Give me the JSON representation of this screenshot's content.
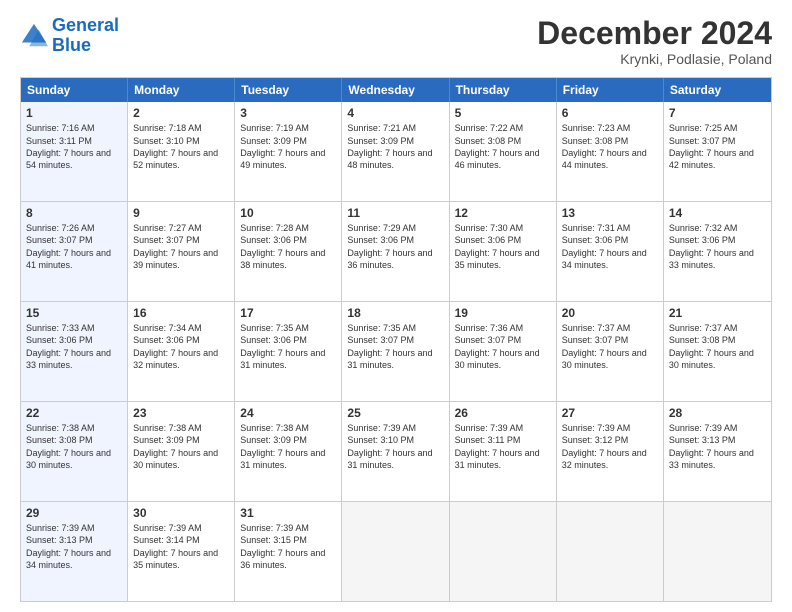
{
  "logo": {
    "line1": "General",
    "line2": "Blue"
  },
  "title": "December 2024",
  "subtitle": "Krynki, Podlasie, Poland",
  "header_days": [
    "Sunday",
    "Monday",
    "Tuesday",
    "Wednesday",
    "Thursday",
    "Friday",
    "Saturday"
  ],
  "rows": [
    [
      {
        "day": "1",
        "sunrise": "Sunrise: 7:16 AM",
        "sunset": "Sunset: 3:11 PM",
        "daylight": "Daylight: 7 hours and 54 minutes.",
        "type": "sunday"
      },
      {
        "day": "2",
        "sunrise": "Sunrise: 7:18 AM",
        "sunset": "Sunset: 3:10 PM",
        "daylight": "Daylight: 7 hours and 52 minutes.",
        "type": "normal"
      },
      {
        "day": "3",
        "sunrise": "Sunrise: 7:19 AM",
        "sunset": "Sunset: 3:09 PM",
        "daylight": "Daylight: 7 hours and 49 minutes.",
        "type": "normal"
      },
      {
        "day": "4",
        "sunrise": "Sunrise: 7:21 AM",
        "sunset": "Sunset: 3:09 PM",
        "daylight": "Daylight: 7 hours and 48 minutes.",
        "type": "normal"
      },
      {
        "day": "5",
        "sunrise": "Sunrise: 7:22 AM",
        "sunset": "Sunset: 3:08 PM",
        "daylight": "Daylight: 7 hours and 46 minutes.",
        "type": "normal"
      },
      {
        "day": "6",
        "sunrise": "Sunrise: 7:23 AM",
        "sunset": "Sunset: 3:08 PM",
        "daylight": "Daylight: 7 hours and 44 minutes.",
        "type": "normal"
      },
      {
        "day": "7",
        "sunrise": "Sunrise: 7:25 AM",
        "sunset": "Sunset: 3:07 PM",
        "daylight": "Daylight: 7 hours and 42 minutes.",
        "type": "normal"
      }
    ],
    [
      {
        "day": "8",
        "sunrise": "Sunrise: 7:26 AM",
        "sunset": "Sunset: 3:07 PM",
        "daylight": "Daylight: 7 hours and 41 minutes.",
        "type": "sunday"
      },
      {
        "day": "9",
        "sunrise": "Sunrise: 7:27 AM",
        "sunset": "Sunset: 3:07 PM",
        "daylight": "Daylight: 7 hours and 39 minutes.",
        "type": "normal"
      },
      {
        "day": "10",
        "sunrise": "Sunrise: 7:28 AM",
        "sunset": "Sunset: 3:06 PM",
        "daylight": "Daylight: 7 hours and 38 minutes.",
        "type": "normal"
      },
      {
        "day": "11",
        "sunrise": "Sunrise: 7:29 AM",
        "sunset": "Sunset: 3:06 PM",
        "daylight": "Daylight: 7 hours and 36 minutes.",
        "type": "normal"
      },
      {
        "day": "12",
        "sunrise": "Sunrise: 7:30 AM",
        "sunset": "Sunset: 3:06 PM",
        "daylight": "Daylight: 7 hours and 35 minutes.",
        "type": "normal"
      },
      {
        "day": "13",
        "sunrise": "Sunrise: 7:31 AM",
        "sunset": "Sunset: 3:06 PM",
        "daylight": "Daylight: 7 hours and 34 minutes.",
        "type": "normal"
      },
      {
        "day": "14",
        "sunrise": "Sunrise: 7:32 AM",
        "sunset": "Sunset: 3:06 PM",
        "daylight": "Daylight: 7 hours and 33 minutes.",
        "type": "normal"
      }
    ],
    [
      {
        "day": "15",
        "sunrise": "Sunrise: 7:33 AM",
        "sunset": "Sunset: 3:06 PM",
        "daylight": "Daylight: 7 hours and 33 minutes.",
        "type": "sunday"
      },
      {
        "day": "16",
        "sunrise": "Sunrise: 7:34 AM",
        "sunset": "Sunset: 3:06 PM",
        "daylight": "Daylight: 7 hours and 32 minutes.",
        "type": "normal"
      },
      {
        "day": "17",
        "sunrise": "Sunrise: 7:35 AM",
        "sunset": "Sunset: 3:06 PM",
        "daylight": "Daylight: 7 hours and 31 minutes.",
        "type": "normal"
      },
      {
        "day": "18",
        "sunrise": "Sunrise: 7:35 AM",
        "sunset": "Sunset: 3:07 PM",
        "daylight": "Daylight: 7 hours and 31 minutes.",
        "type": "normal"
      },
      {
        "day": "19",
        "sunrise": "Sunrise: 7:36 AM",
        "sunset": "Sunset: 3:07 PM",
        "daylight": "Daylight: 7 hours and 30 minutes.",
        "type": "normal"
      },
      {
        "day": "20",
        "sunrise": "Sunrise: 7:37 AM",
        "sunset": "Sunset: 3:07 PM",
        "daylight": "Daylight: 7 hours and 30 minutes.",
        "type": "normal"
      },
      {
        "day": "21",
        "sunrise": "Sunrise: 7:37 AM",
        "sunset": "Sunset: 3:08 PM",
        "daylight": "Daylight: 7 hours and 30 minutes.",
        "type": "normal"
      }
    ],
    [
      {
        "day": "22",
        "sunrise": "Sunrise: 7:38 AM",
        "sunset": "Sunset: 3:08 PM",
        "daylight": "Daylight: 7 hours and 30 minutes.",
        "type": "sunday"
      },
      {
        "day": "23",
        "sunrise": "Sunrise: 7:38 AM",
        "sunset": "Sunset: 3:09 PM",
        "daylight": "Daylight: 7 hours and 30 minutes.",
        "type": "normal"
      },
      {
        "day": "24",
        "sunrise": "Sunrise: 7:38 AM",
        "sunset": "Sunset: 3:09 PM",
        "daylight": "Daylight: 7 hours and 31 minutes.",
        "type": "normal"
      },
      {
        "day": "25",
        "sunrise": "Sunrise: 7:39 AM",
        "sunset": "Sunset: 3:10 PM",
        "daylight": "Daylight: 7 hours and 31 minutes.",
        "type": "normal"
      },
      {
        "day": "26",
        "sunrise": "Sunrise: 7:39 AM",
        "sunset": "Sunset: 3:11 PM",
        "daylight": "Daylight: 7 hours and 31 minutes.",
        "type": "normal"
      },
      {
        "day": "27",
        "sunrise": "Sunrise: 7:39 AM",
        "sunset": "Sunset: 3:12 PM",
        "daylight": "Daylight: 7 hours and 32 minutes.",
        "type": "normal"
      },
      {
        "day": "28",
        "sunrise": "Sunrise: 7:39 AM",
        "sunset": "Sunset: 3:13 PM",
        "daylight": "Daylight: 7 hours and 33 minutes.",
        "type": "normal"
      }
    ],
    [
      {
        "day": "29",
        "sunrise": "Sunrise: 7:39 AM",
        "sunset": "Sunset: 3:13 PM",
        "daylight": "Daylight: 7 hours and 34 minutes.",
        "type": "sunday"
      },
      {
        "day": "30",
        "sunrise": "Sunrise: 7:39 AM",
        "sunset": "Sunset: 3:14 PM",
        "daylight": "Daylight: 7 hours and 35 minutes.",
        "type": "normal"
      },
      {
        "day": "31",
        "sunrise": "Sunrise: 7:39 AM",
        "sunset": "Sunset: 3:15 PM",
        "daylight": "Daylight: 7 hours and 36 minutes.",
        "type": "normal"
      },
      {
        "day": "",
        "sunrise": "",
        "sunset": "",
        "daylight": "",
        "type": "empty"
      },
      {
        "day": "",
        "sunrise": "",
        "sunset": "",
        "daylight": "",
        "type": "empty"
      },
      {
        "day": "",
        "sunrise": "",
        "sunset": "",
        "daylight": "",
        "type": "empty"
      },
      {
        "day": "",
        "sunrise": "",
        "sunset": "",
        "daylight": "",
        "type": "empty"
      }
    ]
  ]
}
